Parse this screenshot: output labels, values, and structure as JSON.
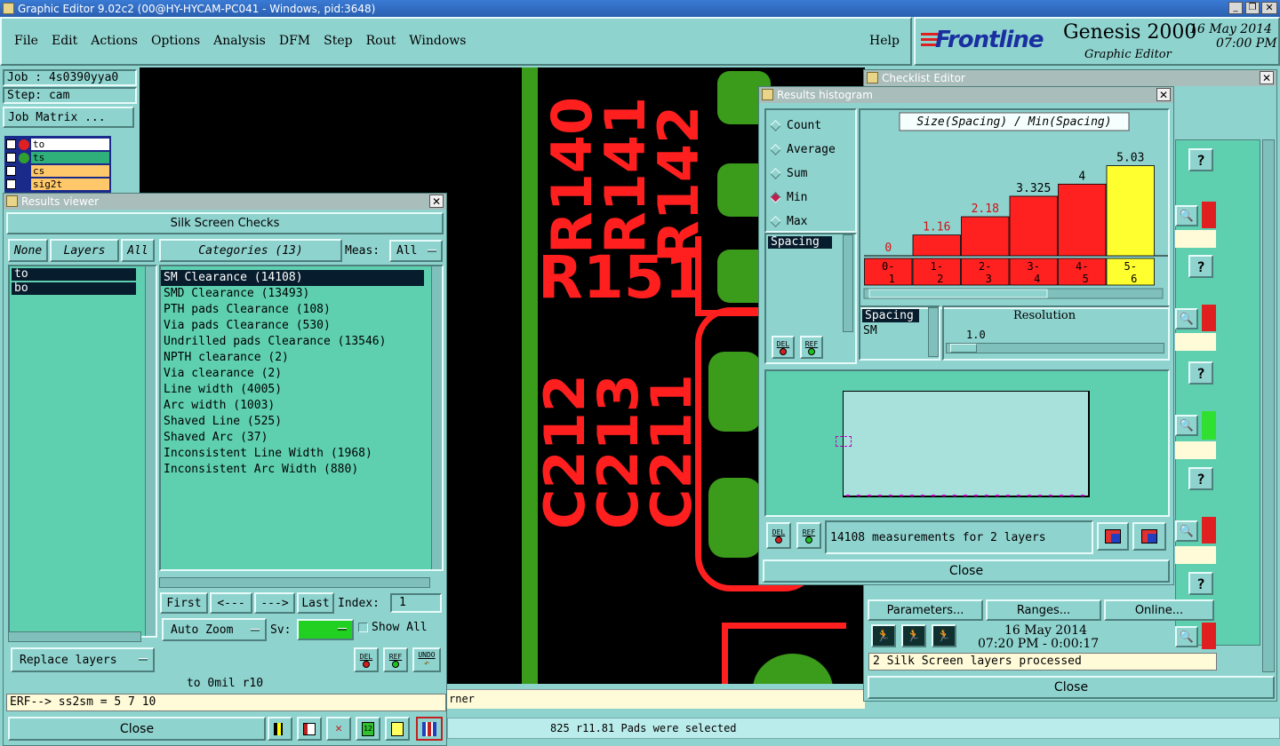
{
  "titlebar": {
    "title": "Graphic Editor 9.02c2 (00@HY-HYCAM-PC041 - Windows, pid:3648)"
  },
  "menu": {
    "items": [
      "File",
      "Edit",
      "Actions",
      "Options",
      "Analysis",
      "DFM",
      "Step",
      "Rout",
      "Windows"
    ],
    "help": "Help"
  },
  "brand": {
    "logo": "Frontline",
    "product": "Genesis 2000",
    "subtitle": "Graphic Editor",
    "date": "16 May 2014",
    "time": "07:00 PM"
  },
  "job": {
    "job_label": "Job : 4s0390yya0",
    "step_label": "Step: cam",
    "matrix_button": "Job Matrix ...",
    "layers": [
      {
        "name": "to",
        "color": "#ffffff"
      },
      {
        "name": "ts",
        "color": "#2fb07a"
      },
      {
        "name": "cs",
        "color": "#ffc86a"
      },
      {
        "name": "sig2t",
        "color": "#ffc86a"
      }
    ]
  },
  "pcb": {
    "labels": [
      "R140",
      "R141",
      "R142",
      "R151",
      "C212",
      "C213",
      "C211"
    ],
    "status_left": "rner",
    "status_bottom": "825 r11.81 Pads were selected"
  },
  "results_viewer": {
    "title": "Results viewer",
    "header": "Silk Screen Checks",
    "none_btn": "None",
    "layers_btn": "Layers",
    "all_btn": "All",
    "categories_btn": "Categories (13)",
    "meas_label": "Meas:",
    "meas_value": "All",
    "layer_items": [
      "to",
      "bo"
    ],
    "categories": [
      "SM Clearance (14108)",
      "SMD Clearance (13493)",
      "PTH pads Clearance (108)",
      "Via pads Clearance (530)",
      "Undrilled pads Clearance (13546)",
      "NPTH clearance (2)",
      "Via clearance (2)",
      "Line width (4005)",
      "Arc width (1003)",
      "Shaved Line (525)",
      "Shaved Arc (37)",
      "Inconsistent Line Width (1968)",
      "Inconsistent Arc Width (880)"
    ],
    "nav": {
      "first": "First",
      "prev": "<---",
      "next": "--->",
      "last": "Last",
      "index_label": "Index:",
      "index_value": "1"
    },
    "auto_zoom": "Auto Zoom",
    "sv_label": "Sv:",
    "show_all": "Show All",
    "replace_layers": "Replace layers",
    "del": "DEL",
    "ref": "REF",
    "undo": "UNDO",
    "status1": "to 0mil  r10",
    "status2": "ERF--> ss2sm = 5 7 10",
    "close": "Close"
  },
  "histogram": {
    "title": "Results histogram",
    "options": [
      {
        "label": "Count",
        "selected": false
      },
      {
        "label": "Average",
        "selected": false
      },
      {
        "label": "Sum",
        "selected": false
      },
      {
        "label": "Min",
        "selected": true
      },
      {
        "label": "Max",
        "selected": false
      }
    ],
    "chart_title": "Size(Spacing) / Min(Spacing)",
    "spacing_item": "Spacing",
    "spacing2_items": [
      "Spacing",
      "SM"
    ],
    "resolution_label": "Resolution",
    "resolution_value": "1.0",
    "measurements": "14108 measurements for 2 layers",
    "close": "Close",
    "del": "DEL",
    "ref": "REF"
  },
  "chart_data": {
    "type": "bar",
    "title": "Size(Spacing) / Min(Spacing)",
    "categories": [
      "0-1",
      "1-2",
      "2-3",
      "3-4",
      "4-5",
      "5-6"
    ],
    "values": [
      0,
      1.16,
      2.18,
      3.325,
      4,
      5.03
    ],
    "value_labels": [
      "0",
      "1.16",
      "2.18",
      "3.325",
      "4",
      "5.03"
    ],
    "colors": [
      "#ff2020",
      "#ff2020",
      "#ff2020",
      "#ff2020",
      "#ff2020",
      "#ffff30"
    ],
    "ylim": [
      0,
      6
    ]
  },
  "checklist": {
    "title": "Checklist Editor",
    "parameters": "Parameters...",
    "ranges": "Ranges...",
    "online": "Online...",
    "date": "16 May 2014",
    "time": "07:20 PM - 0:00:17",
    "status": "2 Silk Screen layers processed",
    "close": "Close"
  }
}
